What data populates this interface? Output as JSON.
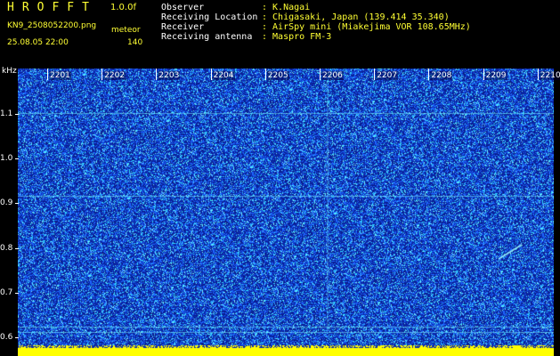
{
  "header": {
    "app_name": "HROFFT",
    "version": "1.0.0f",
    "file_name": "KN9_2508052200.png",
    "mode_label": "meteor",
    "date_time": "25.08.05 22:00",
    "count_value": "140"
  },
  "info": [
    {
      "label": "Observer",
      "value": ": K.Nagai"
    },
    {
      "label": "Receiving Location",
      "value": ": Chigasaki, Japan (139.414 35.340)"
    },
    {
      "label": "Receiver",
      "value": ": AirSpy mini (Miakejima VOR 108.65MHz)"
    },
    {
      "label": "Receiving antenna",
      "value": ": Maspro FM-3"
    }
  ],
  "axis": {
    "y_unit": "kHz",
    "y_ticks": [
      {
        "label": "1.1",
        "value": 1.1
      },
      {
        "label": "1.0",
        "value": 1.0
      },
      {
        "label": "0.9",
        "value": 0.9
      },
      {
        "label": "0.8",
        "value": 0.8
      },
      {
        "label": "0.7",
        "value": 0.7
      },
      {
        "label": "0.6",
        "value": 0.6
      }
    ],
    "x_ticks": [
      "2201",
      "2202",
      "2203",
      "2204",
      "2205",
      "2206",
      "2207",
      "2208",
      "2209",
      "2210"
    ]
  },
  "colors": {
    "background": "#000000",
    "spectrogram_base": "#0a2bb0",
    "noise_light": "#33ddff",
    "noise_mid": "#1e66ff",
    "noise_dark": "#0a1a88",
    "bottom_strip": "#ffff00",
    "label_yellow": "#ffff33"
  }
}
